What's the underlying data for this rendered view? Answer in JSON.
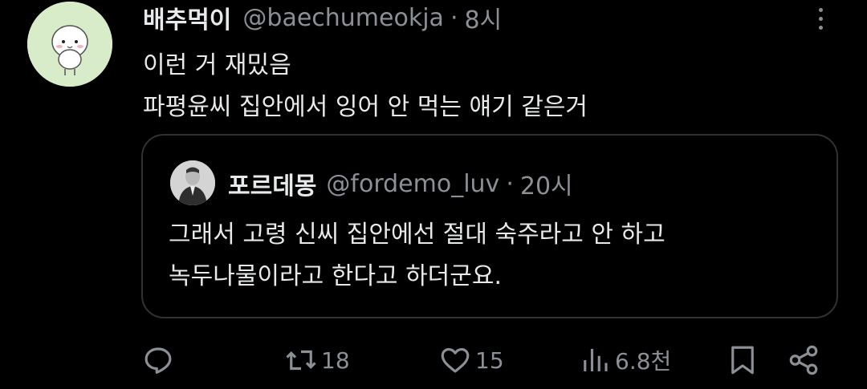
{
  "tweet": {
    "display_name": "배추먹이",
    "handle": "@baechumeokja",
    "separator": "·",
    "time": "8시",
    "lines": [
      "이런 거 재밌음",
      "파평윤씨 집안에서 잉어 안 먹는 얘기 같은거"
    ]
  },
  "quoted": {
    "display_name": "포르데몽",
    "handle": "@fordemo_luv",
    "separator": "·",
    "time": "20시",
    "lines": [
      "그래서 고령 신씨 집안에선 절대 숙주라고 안 하고",
      "녹두나물이라고 한다고 하더군요."
    ]
  },
  "actions": {
    "reply_icon": "reply-icon",
    "retweet_icon": "retweet-icon",
    "retweet_count": "18",
    "like_icon": "heart-icon",
    "like_count": "15",
    "views_icon": "views-bar-chart-icon",
    "view_count": "6.8천",
    "bookmark_icon": "bookmark-icon",
    "share_icon": "share-icon"
  },
  "colors": {
    "background": "#000000",
    "text": "#e7e9ea",
    "muted": "#8b9096",
    "border": "#2f3336",
    "avatar_bg": "#d9ecca"
  }
}
